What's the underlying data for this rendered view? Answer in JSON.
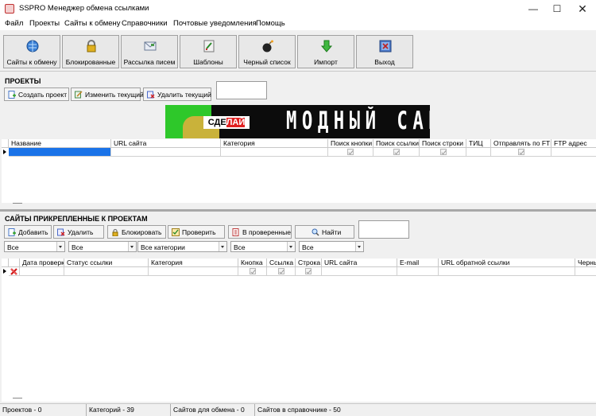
{
  "window": {
    "title": "SSPRO Менеджер обмена ссылками"
  },
  "menu": [
    "Файл",
    "Проекты",
    "Сайты к обмену",
    "Справочники",
    "Почтовые уведомления",
    "Помощь"
  ],
  "toolbar": [
    {
      "label": "Сайты к обмену",
      "icon": "globe-icon"
    },
    {
      "label": "Блокированные",
      "icon": "lock-icon"
    },
    {
      "label": "Рассылка писем",
      "icon": "mail-icon"
    },
    {
      "label": "Шаблоны",
      "icon": "template-icon"
    },
    {
      "label": "Черный список",
      "icon": "bomb-icon"
    },
    {
      "label": "Импорт",
      "icon": "import-arrow-icon"
    },
    {
      "label": "Выход",
      "icon": "exit-icon"
    }
  ],
  "projects": {
    "title": "ПРОЕКТЫ",
    "buttons": [
      "Создать проект",
      "Изменить текущий",
      "Удалить текущий"
    ],
    "columns": [
      "Название",
      "URL сайта",
      "Категория",
      "Поиск кнопки",
      "Поиск ссылки",
      "Поиск строки",
      "ТИЦ",
      "Отправлять по FTP",
      "FTP адрес"
    ]
  },
  "banner": {
    "small": "СДЕ",
    "small_hi": "ЛАЙ",
    "big": "МОДНЫЙ САЙТ"
  },
  "linked_sites": {
    "title": "САЙТЫ ПРИКРЕПЛЕННЫЕ К ПРОЕКТАМ",
    "buttons": [
      "Добавить",
      "Удалить",
      "Блокировать",
      "Проверить",
      "В проверенные",
      "Найти"
    ],
    "filters": [
      "Все",
      "Все",
      "Все категории",
      "Все",
      "Все"
    ],
    "columns": [
      "Дата проверк",
      "Статус ссылки",
      "Категория",
      "Кнопка",
      "Ссылка",
      "Строка",
      "URL сайта",
      "E-mail",
      "URL обратной ссылки",
      "Черны"
    ]
  },
  "status": [
    "Проектов - 0",
    "Категорий - 39",
    "Сайтов для обмена - 0",
    "Сайтов в справочнике - 50"
  ]
}
